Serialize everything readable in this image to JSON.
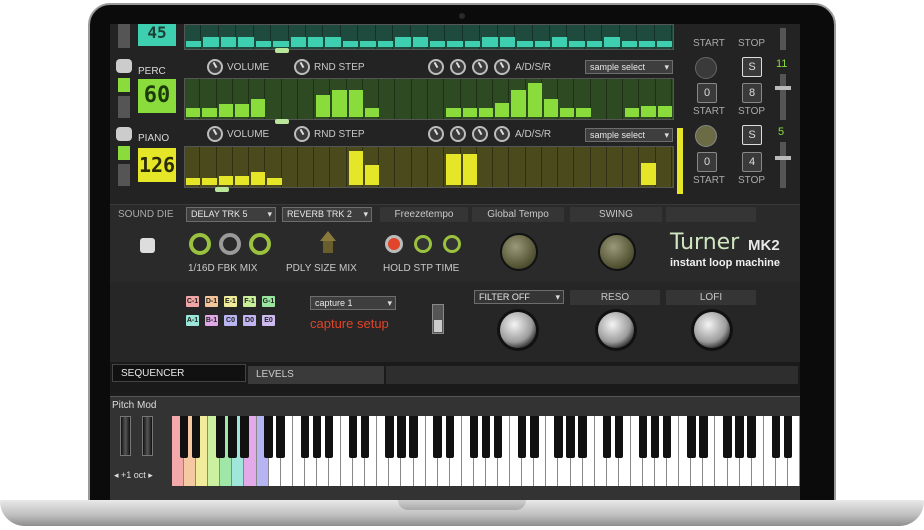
{
  "tracks": [
    {
      "name": "",
      "value": "45",
      "steps": [
        0.3,
        0.5,
        0.5,
        0.5,
        0.3,
        0.3,
        0.5,
        0.5,
        0.5,
        0.3,
        0.3,
        0.3,
        0.5,
        0.5,
        0.3,
        0.3,
        0.3,
        0.5,
        0.5,
        0.3,
        0.3,
        0.5,
        0.3,
        0.3,
        0.5,
        0.3,
        0.3,
        0.3
      ],
      "color": "#3ecfb0",
      "volume_label": "VOLUME",
      "rnd_label": "RND STEP"
    },
    {
      "name": "PERC",
      "value": "60",
      "steps": [
        0.25,
        0.25,
        0.35,
        0.35,
        0.5,
        0,
        0,
        0,
        0.6,
        0.75,
        0.75,
        0.25,
        0,
        0,
        0,
        0,
        0.25,
        0.25,
        0.25,
        0.4,
        0.75,
        0.95,
        0.5,
        0.25,
        0.25,
        0,
        0,
        0.25,
        0.3,
        0.3
      ],
      "color": "#8adc3c",
      "volume_label": "VOLUME",
      "rnd_label": "RND STEP",
      "adsr": "A/D/S/R",
      "sample": "sample select",
      "start_val": "0",
      "stop_val": "8",
      "start_label": "START",
      "stop_label": "STOP",
      "s_label": "S",
      "level": "11"
    },
    {
      "name": "PIANO",
      "value": "126",
      "steps": [
        0.2,
        0.2,
        0.25,
        0.25,
        0.35,
        0.2,
        0,
        0,
        0,
        0,
        0.95,
        0.55,
        0,
        0,
        0,
        0,
        0.85,
        0.85,
        0,
        0,
        0,
        0,
        0,
        0,
        0,
        0,
        0,
        0,
        0.6,
        0
      ],
      "color": "#e6e628",
      "volume_label": "VOLUME",
      "rnd_label": "RND STEP",
      "adsr": "A/D/S/R",
      "sample": "sample select",
      "start_val": "0",
      "stop_val": "4",
      "start_label": "START",
      "stop_label": "STOP",
      "s_label": "S",
      "level": "5"
    }
  ],
  "top_start_label": "START",
  "top_stop_label": "STOP",
  "fx": {
    "sound_die": "SOUND DIE",
    "delay_select": "DELAY TRK 5",
    "reverb_select": "REVERB TRK 2",
    "freeze_header": "Freezetempo",
    "global_tempo_header": "Global Tempo",
    "swing_header": "SWING",
    "delay_labels": "1/16D FBK  MIX",
    "reverb_labels": "PDLY SIZE MIX",
    "freeze_labels": "HOLD STP TIME"
  },
  "brand": {
    "name": "Turner",
    "model": "MK2",
    "tagline": "instant loop machine"
  },
  "capture": {
    "notes": [
      {
        "label": "C-1",
        "color": "#f2a7a7"
      },
      {
        "label": "D-1",
        "color": "#f4c49a"
      },
      {
        "label": "E-1",
        "color": "#f0ec9a"
      },
      {
        "label": "F-1",
        "color": "#c9ef9a"
      },
      {
        "label": "G-1",
        "color": "#9ae6a0"
      },
      {
        "label": "A-1",
        "color": "#9ae6d9"
      },
      {
        "label": "B-1",
        "color": "#e0a8e6"
      },
      {
        "label": "C0",
        "color": "#b9b5f2"
      },
      {
        "label": "D0",
        "color": "#c3b4f2"
      },
      {
        "label": "E0",
        "color": "#cdbaf0"
      }
    ],
    "select": "capture 1",
    "setup_label": "capture setup"
  },
  "filter": {
    "select": "FILTER OFF",
    "reso": "RESO",
    "lofi": "LOFI"
  },
  "tabs": [
    {
      "label": "SEQUENCER"
    },
    {
      "label": "LEVELS"
    }
  ],
  "keyboard": {
    "pitch_mod": "Pitch Mod",
    "octave": "◂ +1 oct ▸"
  },
  "colors": {
    "accent_yellow": "#e6e628",
    "accent_green": "#8adc3c",
    "accent_teal": "#3ecfb0",
    "capture_red": "#e0442a"
  }
}
